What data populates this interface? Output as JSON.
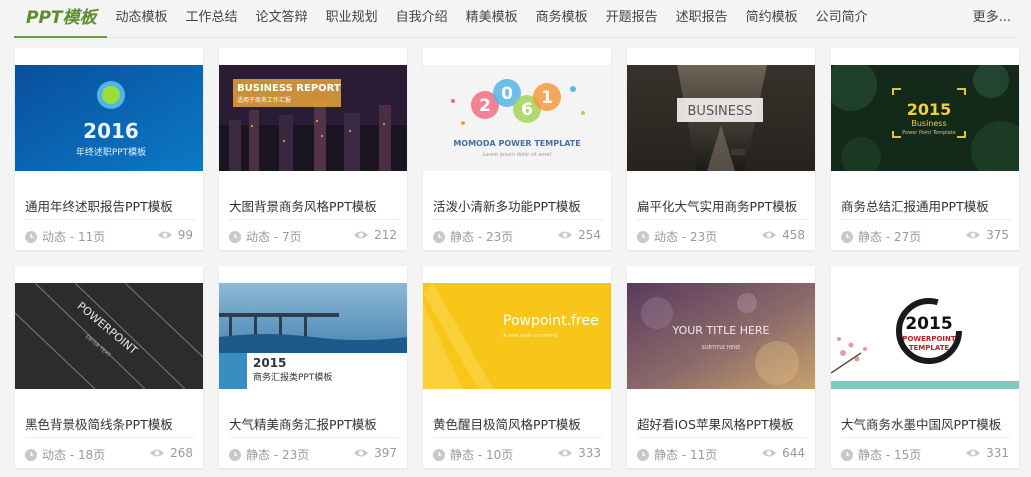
{
  "nav": {
    "brand": "PPT模板",
    "items": [
      "动态模板",
      "工作总结",
      "论文答辩",
      "职业规划",
      "自我介绍",
      "精美模板",
      "商务模板",
      "开题报告",
      "述职报告",
      "简约模板",
      "公司简介"
    ],
    "more": "更多..."
  },
  "cards": [
    {
      "title": "通用年终述职报告PPT模板",
      "meta": "动态 - 11页",
      "views": "99",
      "thumb": {
        "line1": "2016",
        "line2": "年终述职PPT模板"
      }
    },
    {
      "title": "大图背景商务风格PPT模板",
      "meta": "动态 - 7页",
      "views": "212",
      "thumb": {
        "line1": "BUSINESS REPORT",
        "line2": "适用于商务工作汇报"
      }
    },
    {
      "title": "活泼小清新多功能PPT模板",
      "meta": "静态 - 23页",
      "views": "254",
      "thumb": {
        "digits": [
          "2",
          "0",
          "6",
          "1"
        ],
        "line1": "MOMODA POWER TEMPLATE",
        "line2": "Lorem ipsum dolor sit amet"
      }
    },
    {
      "title": "扁平化大气实用商务PPT模板",
      "meta": "动态 - 23页",
      "views": "458",
      "thumb": {
        "line1": "BUSINESS"
      }
    },
    {
      "title": "商务总结汇报通用PPT模板",
      "meta": "静态 - 27页",
      "views": "375",
      "thumb": {
        "line1": "2015",
        "line2": "Business",
        "line3": "Power Point Template"
      }
    },
    {
      "title": "黑色背景极简线条PPT模板",
      "meta": "动态 - 18页",
      "views": "268",
      "thumb": {
        "line1": "POWERPOINT",
        "line2": "ENTER TEXT"
      }
    },
    {
      "title": "大气精美商务汇报PPT模板",
      "meta": "静态 - 23页",
      "views": "397",
      "thumb": {
        "line1": "2015",
        "line2": "商务汇报类PPT模板"
      }
    },
    {
      "title": "黄色醒目极简风格PPT模板",
      "meta": "静态 - 10页",
      "views": "333",
      "thumb": {
        "line1": "Powpoint.free",
        "line2": "A new style is coming"
      }
    },
    {
      "title": "超好看IOS苹果风格PPT模板",
      "meta": "静态 - 11页",
      "views": "644",
      "thumb": {
        "line1": "YOUR TITLE HERE",
        "line2": "SUBTITLE HERE"
      }
    },
    {
      "title": "大气商务水墨中国风PPT模板",
      "meta": "静态 - 15页",
      "views": "331",
      "thumb": {
        "line1": "2015",
        "line2": "POWERPOINT",
        "line3": "TEMPLATE"
      }
    }
  ],
  "colors": {
    "brand": "#5c8d2e",
    "meta_text": "#999999"
  },
  "icons": {
    "time": "clock-icon",
    "views": "eye-icon"
  }
}
